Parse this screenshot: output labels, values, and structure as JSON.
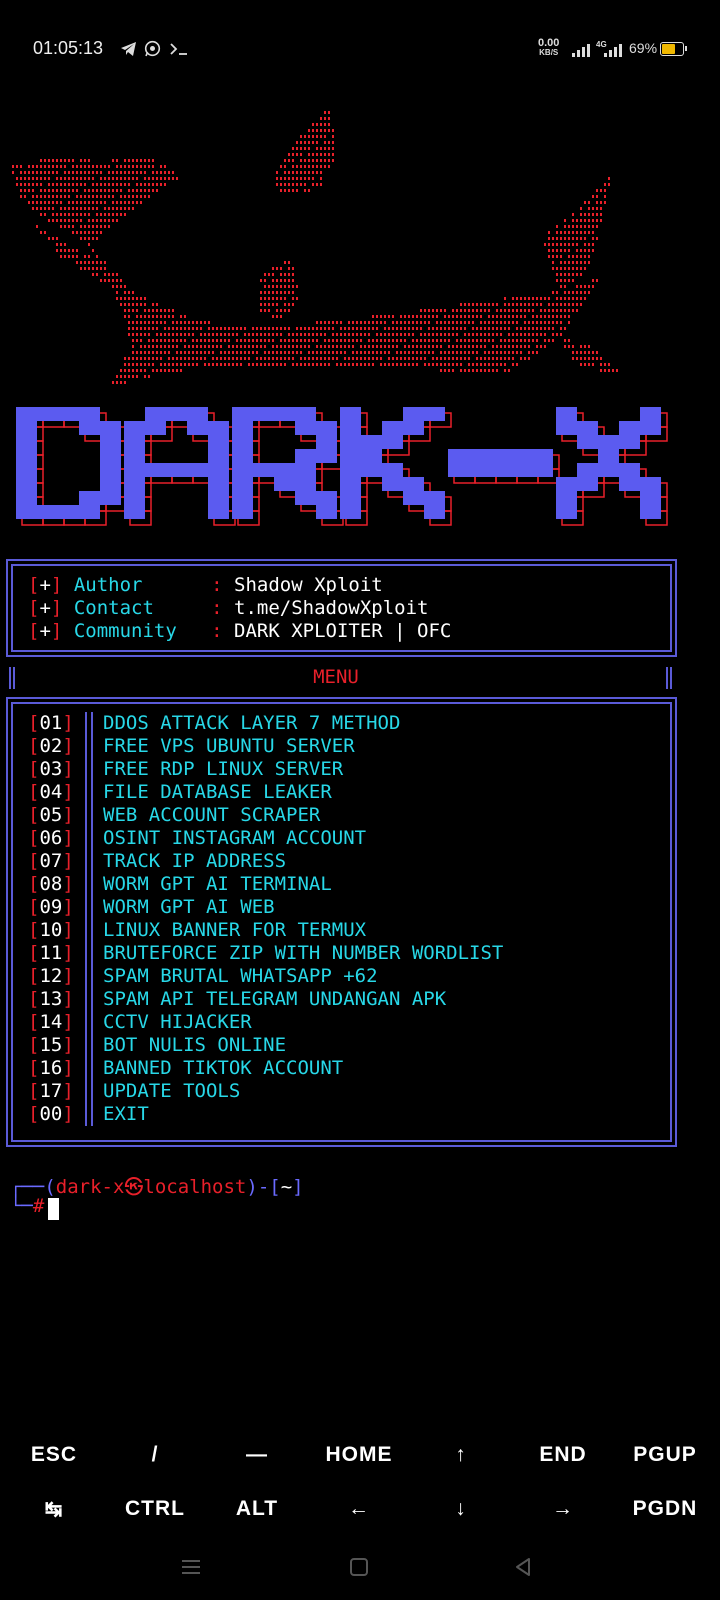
{
  "status_bar": {
    "time": "01:05:13",
    "notification_icons": [
      "telegram-icon",
      "whatsapp-icon",
      "terminal-icon"
    ],
    "net_speed_value": "0.00",
    "net_speed_unit": "KB/S",
    "network_type": "4G",
    "battery_percent": "69%",
    "battery_level": 0.69,
    "battery_color": "#f0b800"
  },
  "banner": {
    "logo_text": "DARK-X",
    "logo_fill_color": "#5b5bf0",
    "logo_outline_color": "#e8202a",
    "shark_color": "#e8202a"
  },
  "info": {
    "rows": [
      {
        "marker": "[+]",
        "key": "Author   ",
        "sep": ":",
        "value": "Shadow Xploit"
      },
      {
        "marker": "[+]",
        "key": "Contact  ",
        "sep": ":",
        "value": "t.me/ShadowXploit"
      },
      {
        "marker": "[+]",
        "key": "Community",
        "sep": ":",
        "value": "DARK XPLOITER | OFC"
      }
    ]
  },
  "menu": {
    "title": "MENU",
    "items": [
      {
        "num": "01",
        "label": "DDOS ATTACK LAYER 7 METHOD"
      },
      {
        "num": "02",
        "label": "FREE VPS UBUNTU SERVER"
      },
      {
        "num": "03",
        "label": "FREE RDP LINUX SERVER"
      },
      {
        "num": "04",
        "label": "FILE DATABASE LEAKER"
      },
      {
        "num": "05",
        "label": "WEB ACCOUNT SCRAPER"
      },
      {
        "num": "06",
        "label": "OSINT INSTAGRAM ACCOUNT"
      },
      {
        "num": "07",
        "label": "TRACK IP ADDRESS"
      },
      {
        "num": "08",
        "label": "WORM GPT AI TERMINAL"
      },
      {
        "num": "09",
        "label": "WORM GPT AI WEB"
      },
      {
        "num": "10",
        "label": "LINUX BANNER FOR TERMUX"
      },
      {
        "num": "11",
        "label": "BRUTEFORCE ZIP WITH NUMBER WORDLIST"
      },
      {
        "num": "12",
        "label": "SPAM BRUTAL WHATSAPP +62"
      },
      {
        "num": "13",
        "label": "SPAM API TELEGRAM UNDANGAN APK"
      },
      {
        "num": "14",
        "label": "CCTV HIJACKER"
      },
      {
        "num": "15",
        "label": "BOT NULIS ONLINE"
      },
      {
        "num": "16",
        "label": "BANNED TIKTOK ACCOUNT"
      },
      {
        "num": "17",
        "label": "UPDATE TOOLS"
      },
      {
        "num": "00",
        "label": "EXIT"
      }
    ]
  },
  "prompt": {
    "user": "dark-x",
    "host": "localhost",
    "dir": "~",
    "symbol": "#"
  },
  "extra_keys": {
    "row1": [
      "ESC",
      "/",
      "—",
      "HOME",
      "↑",
      "END",
      "PGUP"
    ],
    "row2": [
      "↹",
      "CTRL",
      "ALT",
      "←",
      "↓",
      "→",
      "PGDN"
    ]
  },
  "nav_bar": [
    "menu-icon",
    "home-icon",
    "back-icon"
  ]
}
